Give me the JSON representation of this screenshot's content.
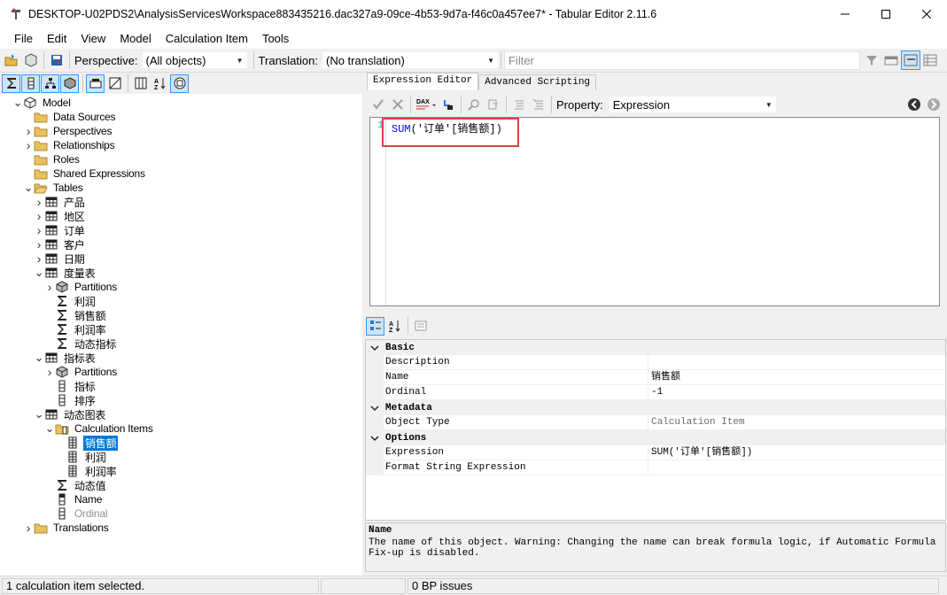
{
  "window": {
    "title": "DESKTOP-U02PDS2\\AnalysisServicesWorkspace883435216.dac327a9-09ce-4b53-9d7a-f46c0a457ee7* - Tabular Editor 2.11.6"
  },
  "menu": [
    "File",
    "Edit",
    "View",
    "Model",
    "Calculation Item",
    "Tools"
  ],
  "toolbar": {
    "perspective_label": "Perspective:",
    "perspective_value": "(All objects)",
    "translation_label": "Translation:",
    "translation_value": "(No translation)",
    "filter_placeholder": "Filter"
  },
  "tree": [
    {
      "label": "Model",
      "icon": "model-cube-icon",
      "expander": "expanded",
      "level": 0
    },
    {
      "label": "Data Sources",
      "icon": "folder-icon",
      "expander": "",
      "level": 1
    },
    {
      "label": "Perspectives",
      "icon": "folder-icon",
      "expander": "collapsed",
      "level": 1
    },
    {
      "label": "Relationships",
      "icon": "folder-icon",
      "expander": "collapsed",
      "level": 1
    },
    {
      "label": "Roles",
      "icon": "folder-icon",
      "expander": "",
      "level": 1
    },
    {
      "label": "Shared Expressions",
      "icon": "folder-icon",
      "expander": "",
      "level": 1
    },
    {
      "label": "Tables",
      "icon": "folder-open-icon",
      "expander": "expanded",
      "level": 1
    },
    {
      "label": "产品",
      "icon": "table-icon",
      "expander": "collapsed",
      "level": 2
    },
    {
      "label": "地区",
      "icon": "table-icon",
      "expander": "collapsed",
      "level": 2
    },
    {
      "label": "订单",
      "icon": "table-icon",
      "expander": "collapsed",
      "level": 2
    },
    {
      "label": "客户",
      "icon": "table-icon",
      "expander": "collapsed",
      "level": 2
    },
    {
      "label": "日期",
      "icon": "table-icon",
      "expander": "collapsed",
      "level": 2
    },
    {
      "label": "度量表",
      "icon": "table-icon",
      "expander": "expanded",
      "level": 2
    },
    {
      "label": "Partitions",
      "icon": "partitions-icon",
      "expander": "collapsed",
      "level": 3
    },
    {
      "label": "利润",
      "icon": "sigma-icon",
      "expander": "",
      "level": 3
    },
    {
      "label": "销售额",
      "icon": "sigma-icon",
      "expander": "",
      "level": 3
    },
    {
      "label": "利润率",
      "icon": "sigma-icon",
      "expander": "",
      "level": 3
    },
    {
      "label": "动态指标",
      "icon": "sigma-icon",
      "expander": "",
      "level": 3
    },
    {
      "label": "指标表",
      "icon": "table-icon",
      "expander": "expanded",
      "level": 2
    },
    {
      "label": "Partitions",
      "icon": "partitions-icon",
      "expander": "collapsed",
      "level": 3
    },
    {
      "label": "指标",
      "icon": "column-icon",
      "expander": "",
      "level": 3
    },
    {
      "label": "排序",
      "icon": "column-icon",
      "expander": "",
      "level": 3
    },
    {
      "label": "动态图表",
      "icon": "table-icon",
      "expander": "expanded",
      "level": 2
    },
    {
      "label": "Calculation Items",
      "icon": "calc-items-icon",
      "expander": "expanded",
      "level": 3
    },
    {
      "label": "销售额",
      "icon": "calc-item-icon",
      "expander": "",
      "level": 4,
      "selected": true
    },
    {
      "label": "利润",
      "icon": "calc-item-icon",
      "expander": "",
      "level": 4
    },
    {
      "label": "利润率",
      "icon": "calc-item-icon",
      "expander": "",
      "level": 4
    },
    {
      "label": "动态值",
      "icon": "sigma-icon",
      "expander": "",
      "level": 3
    },
    {
      "label": "Name",
      "icon": "column-dark-icon",
      "expander": "",
      "level": 3
    },
    {
      "label": "Ordinal",
      "icon": "column-icon",
      "expander": "",
      "level": 3,
      "dim": true
    },
    {
      "label": "Translations",
      "icon": "folder-icon",
      "expander": "collapsed",
      "level": 1
    }
  ],
  "editor": {
    "tabs": [
      "Expression Editor",
      "Advanced Scripting"
    ],
    "property_label": "Property:",
    "property_value": "Expression",
    "line_number": "1",
    "code_fn": "SUM",
    "code_open": "(",
    "code_table": "'订单'",
    "code_col": "[销售额]",
    "code_close": ")"
  },
  "properties": [
    {
      "type": "cat",
      "name": "Basic"
    },
    {
      "type": "row",
      "name": "Description",
      "value": ""
    },
    {
      "type": "row",
      "name": "Name",
      "value": "销售额"
    },
    {
      "type": "row",
      "name": "Ordinal",
      "value": "-1"
    },
    {
      "type": "cat",
      "name": "Metadata"
    },
    {
      "type": "row",
      "name": "Object Type",
      "value": "Calculation Item",
      "readonly": true
    },
    {
      "type": "cat",
      "name": "Options"
    },
    {
      "type": "row",
      "name": "Expression",
      "value": "SUM('订单'[销售额])"
    },
    {
      "type": "row",
      "name": "Format String Expression",
      "value": ""
    }
  ],
  "description": {
    "title": "Name",
    "text": "The name of this object. Warning: Changing the name can break formula logic, if Automatic Formula Fix-up is disabled."
  },
  "status": {
    "left": "1 calculation item selected.",
    "bp": "0 BP issues"
  },
  "colors": {
    "selection": "#0078d7",
    "highlight_box": "#e04040",
    "dax_function": "#0000ff"
  }
}
